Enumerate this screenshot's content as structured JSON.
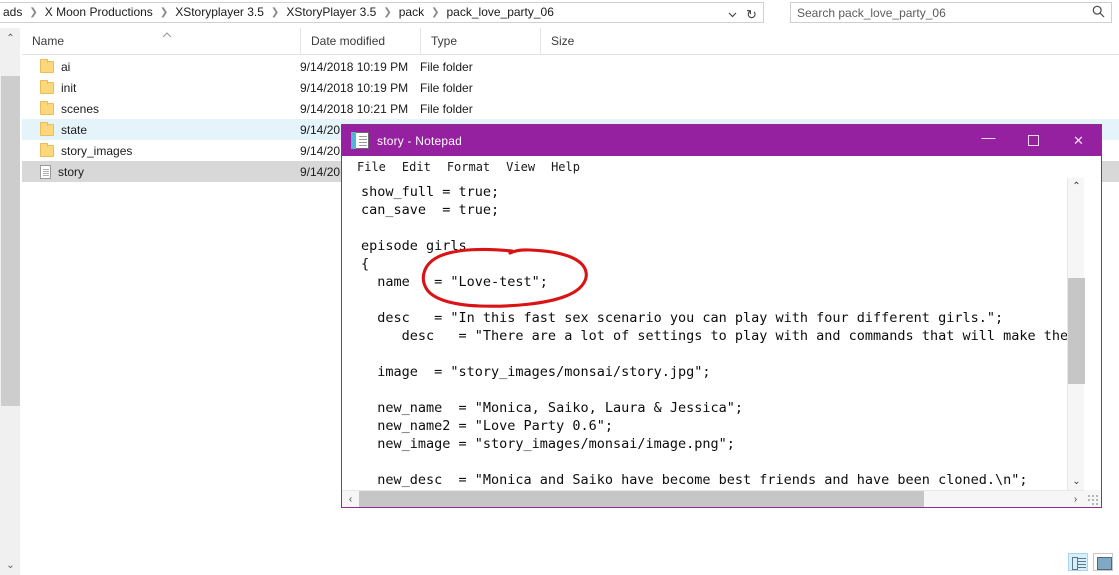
{
  "explorer": {
    "address_bar": {
      "breadcrumbs": [
        "ads",
        "X Moon Productions",
        "XStoryplayer 3.5",
        "XStoryPlayer 3.5",
        "pack",
        "pack_love_party_06"
      ],
      "separator": "❯",
      "dropdown_icon": "chevron-down",
      "refresh_icon": "↻"
    },
    "search": {
      "placeholder": "Search pack_love_party_06",
      "icon": "search-icon"
    },
    "columns": [
      {
        "label": "Name",
        "sorted": true,
        "sort_arrow": "⌃"
      },
      {
        "label": "Date modified"
      },
      {
        "label": "Type"
      },
      {
        "label": "Size"
      }
    ],
    "rows": [
      {
        "name": "ai",
        "icon": "folder",
        "date": "9/14/2018 10:19 PM",
        "type": "File folder",
        "size": "",
        "state": "normal"
      },
      {
        "name": "init",
        "icon": "folder",
        "date": "9/14/2018 10:19 PM",
        "type": "File folder",
        "size": "",
        "state": "normal"
      },
      {
        "name": "scenes",
        "icon": "folder",
        "date": "9/14/2018 10:21 PM",
        "type": "File folder",
        "size": "",
        "state": "normal"
      },
      {
        "name": "state",
        "icon": "folder",
        "date": "9/14/20",
        "type": "",
        "size": "",
        "state": "hovered"
      },
      {
        "name": "story_images",
        "icon": "folder",
        "date": "9/14/20",
        "type": "",
        "size": "",
        "state": "normal"
      },
      {
        "name": "story",
        "icon": "file",
        "date": "9/14/20",
        "type": "",
        "size": "",
        "state": "selected"
      }
    ],
    "status_bar": {
      "view_details_icon": "details-view-icon",
      "view_large_icon": "large-icons-view-icon"
    },
    "nav_scrollbar": {
      "up": "⌃",
      "down": "⌄"
    }
  },
  "notepad": {
    "title": "story - Notepad",
    "title_bar_color": "#9520a0",
    "icon": "notepad-icon",
    "window_controls": {
      "minimize": "—",
      "maximize": "□",
      "close": "✕"
    },
    "menu": [
      "File",
      "Edit",
      "Format",
      "View",
      "Help"
    ],
    "content": "show_full = true;\ncan_save  = true;\n\nepisode girls\n{\n  name   = \"Love-test\";\n\n  desc   = \"In this fast sex scenario you can play with four different girls.\";\n     desc   = \"There are a lot of settings to play with and commands that will make the g\n\n  image  = \"story_images/monsai/story.jpg\";\n\n  new_name  = \"Monica, Saiko, Laura & Jessica\";\n  new_name2 = \"Love Party 0.6\";\n  new_image = \"story_images/monsai/image.png\";\n\n  new_desc  = \"Monica and Saiko have become best friends and have been cloned.\\n\";",
    "vscrollbar": {
      "up": "⌃",
      "down": "⌄"
    },
    "hscrollbar": {
      "left": "‹",
      "right": "›"
    }
  },
  "annotation": {
    "kind": "hand-drawn-ellipse",
    "color": "#d81414",
    "encircles": "= \"Love-test\";"
  }
}
